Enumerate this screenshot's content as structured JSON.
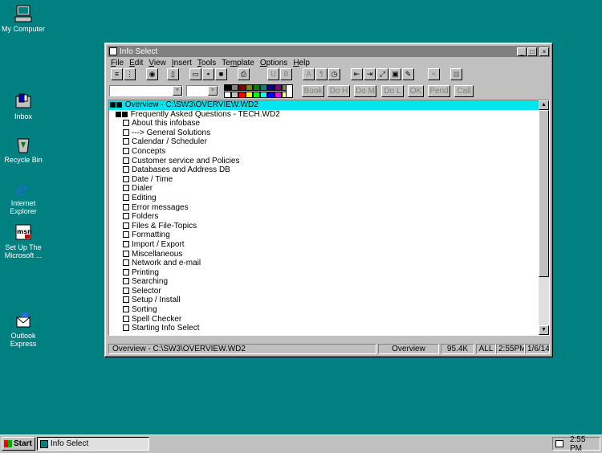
{
  "desktop": {
    "icons": [
      {
        "label": "My Computer"
      },
      {
        "label": "Inbox"
      },
      {
        "label": "Recycle Bin"
      },
      {
        "label": "Internet\nExplorer"
      },
      {
        "label": "Set Up The\nMicrosoft ..."
      },
      {
        "label": "Outlook\nExpress"
      }
    ]
  },
  "window": {
    "title": "Info Select",
    "menu": [
      "File",
      "Edit",
      "View",
      "Insert",
      "Tools",
      "Template",
      "Options",
      "Help"
    ],
    "menu_mnemonics": [
      "F",
      "E",
      "V",
      "I",
      "T",
      "m",
      "O",
      "H"
    ],
    "toolbar2": {
      "palette_colors": [
        "#000000",
        "#808080",
        "#800000",
        "#808000",
        "#008000",
        "#008080",
        "#000080",
        "#800080",
        "#808040",
        "#ffffff",
        "#c0c0c0",
        "#ff0000",
        "#ffff00",
        "#00ff00",
        "#00ffff",
        "#0000ff",
        "#ff00ff",
        "#ffff80"
      ],
      "buttons": [
        "Book",
        "Do H",
        "Do M",
        "Do L",
        "OK",
        "Pend",
        "Call"
      ]
    },
    "tree": {
      "root": "Overview - C:\\SW3\\OVERVIEW.WD2",
      "child": "Frequently Asked Questions - TECH.WD2",
      "items": [
        "About this infobase",
        "---> General Solutions",
        "Calendar / Scheduler",
        "Concepts",
        "Customer service and Policies",
        "Databases and Address DB",
        "Date / Time",
        "Dialer",
        "Editing",
        "Error messages",
        "Folders",
        "Files & File-Topics",
        "Formatting",
        "Import / Export",
        "Miscellaneous",
        "Network and e-mail",
        "Printing",
        "Searching",
        "Selector",
        "Setup / Install",
        "Sorting",
        "Spell Checker",
        "Starting Info Select"
      ]
    },
    "status": {
      "path": "Overview - C:\\SW3\\OVERVIEW.WD2",
      "view": "Overview",
      "size": "95.4K",
      "scope": "ALL",
      "time": "2:55PM",
      "date": "1/6/14"
    }
  },
  "taskbar": {
    "start_label": "Start",
    "task_label": "Info Select",
    "clock": "2:55 PM"
  }
}
